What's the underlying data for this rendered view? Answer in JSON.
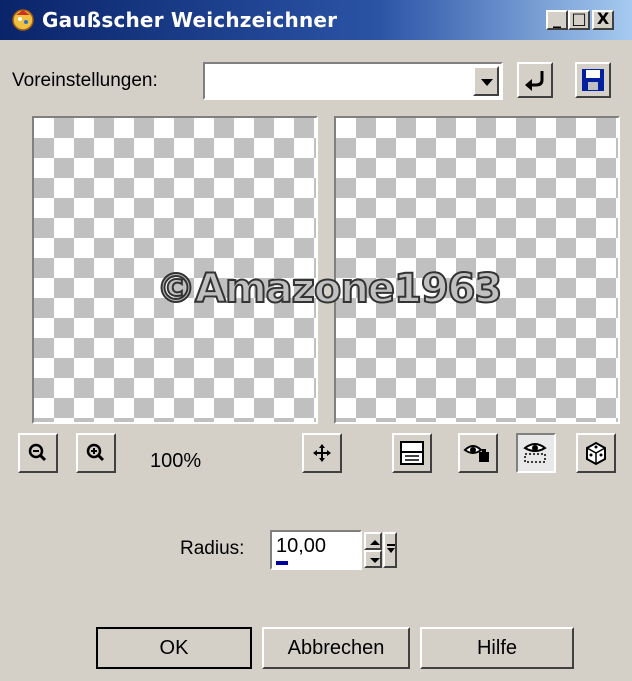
{
  "window": {
    "title": "Gaußscher Weichzeichner",
    "title_bar_color": "#0a246a",
    "buttons": {
      "minimize": "_",
      "maximize": "□",
      "close": "X"
    }
  },
  "presets": {
    "label": "Voreinstellungen:",
    "value": "",
    "reset_icon": "reset-arrow-icon",
    "save_icon": "floppy-disk-icon"
  },
  "preview": {
    "watermark": "©Amazone1963",
    "zoom_level": "100%"
  },
  "toolbar": {
    "zoom_out_icon": "zoom-out-icon",
    "zoom_in_icon": "zoom-in-icon",
    "pan_icon": "move-icon",
    "proof_icon": "layout-toggle-icon",
    "before_icon": "eye-before-icon",
    "after_icon": "eye-after-icon",
    "random_icon": "dice-icon"
  },
  "radius": {
    "label": "Radius:",
    "value": "10,00"
  },
  "dialog_buttons": {
    "ok": "OK",
    "cancel": "Abbrechen",
    "help": "Hilfe"
  }
}
